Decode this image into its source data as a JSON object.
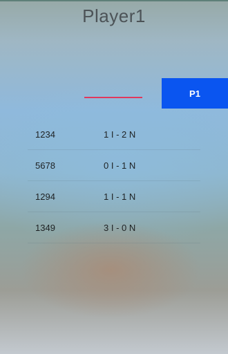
{
  "header": {
    "title": "Player1"
  },
  "entry": {
    "value": "",
    "placeholder": ""
  },
  "actions": {
    "p1_label": "P1"
  },
  "results": [
    {
      "code": "1234",
      "score": "1 I - 2 N"
    },
    {
      "code": "5678",
      "score": "0 I - 1 N"
    },
    {
      "code": "1294",
      "score": "1 I - 1 N"
    },
    {
      "code": "1349",
      "score": "3 I - 0 N"
    }
  ],
  "colors": {
    "accent": "#0a55f0",
    "underline": "#e0385d",
    "title": "#4c5357"
  }
}
